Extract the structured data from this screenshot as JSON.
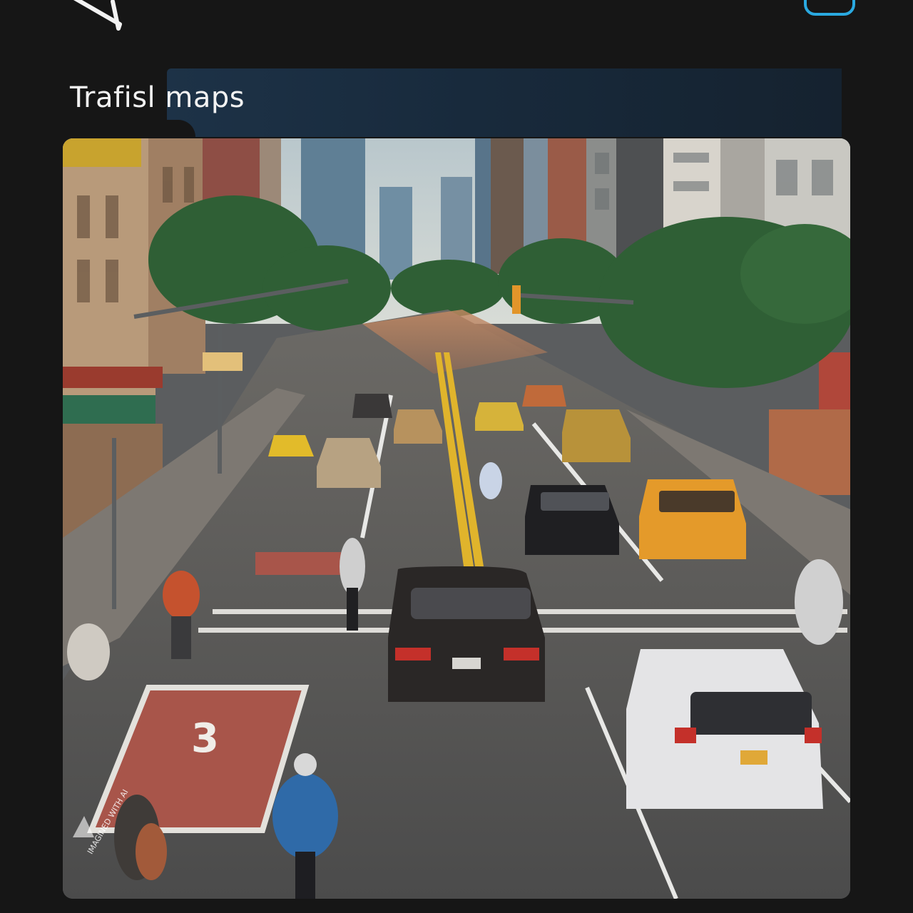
{
  "header": {
    "title": "Trafisl  maps",
    "back_icon": "back-arrow-icon",
    "action_icon": "share-box-icon",
    "accent_color": "#2aa9e0",
    "band_color": "#1d3247"
  },
  "image": {
    "description_icon": "street-photo-image",
    "watermark": "IMAGINED WITH AI"
  }
}
